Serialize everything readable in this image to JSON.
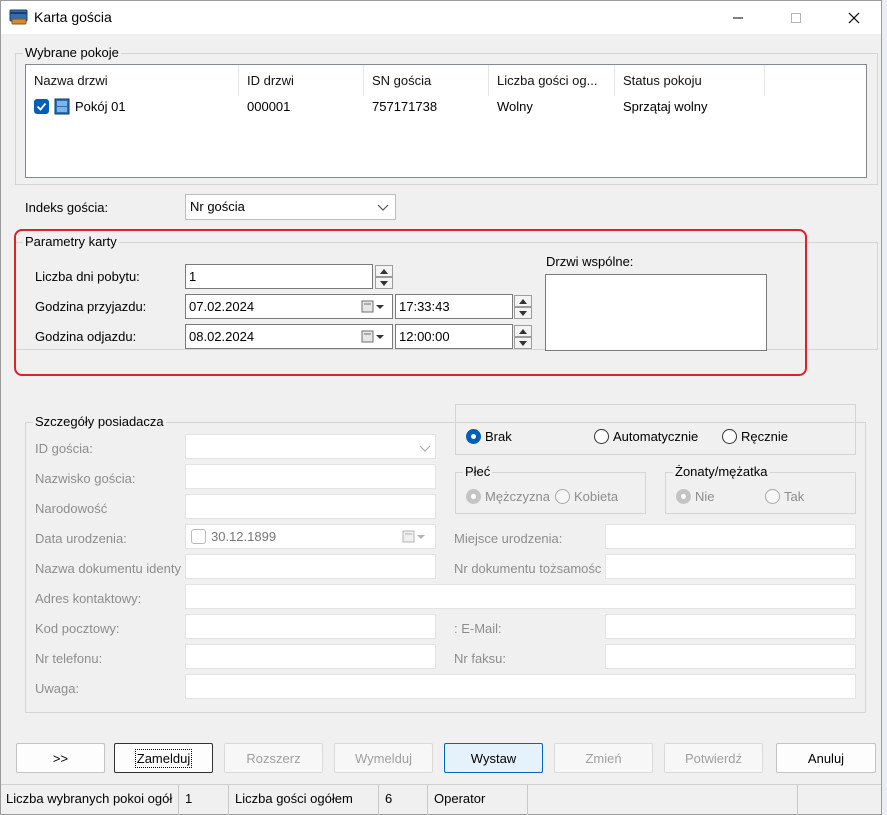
{
  "window": {
    "title": "Karta gościa"
  },
  "rooms_group": {
    "title": "Wybrane pokoje",
    "columns": [
      "Nazwa drzwi",
      "ID drzwi",
      "SN gościa",
      "Liczba gości og...",
      "Status pokoju"
    ],
    "rows": [
      {
        "name": "Pokój 01",
        "id": "000001",
        "sn": "757171738",
        "guests": "Wolny",
        "status": "Sprzątaj wolny",
        "checked": true
      }
    ]
  },
  "index": {
    "label": "Indeks gościa:",
    "value": "Nr gościa"
  },
  "card_params": {
    "title": "Parametry karty",
    "days_label": "Liczba dni pobytu:",
    "days_value": "1",
    "arrival_label": "Godzina przyjazdu:",
    "arrival_date": "07.02.2024",
    "arrival_time": "17:33:43",
    "departure_label": "Godzina odjazdu:",
    "departure_date": "08.02.2024",
    "departure_time": "12:00:00",
    "common_doors_label": "Drzwi wspólne:"
  },
  "holder": {
    "title": "Szczegóły posiadacza",
    "guest_id_label": "ID gościa:",
    "surname_label": "Nazwisko gościa:",
    "nationality_label": "Narodowość",
    "birth_date_label": "Data urodzenia:",
    "birth_date_value": "30.12.1899",
    "doc_name_label": "Nazwa dokumentu identy",
    "address_label": "Adres kontaktowy:",
    "postal_label": "Kod pocztowy:",
    "phone_label": "Nr telefonu:",
    "note_label": "Uwaga:",
    "birth_place_label": "Miejsce urodzenia:",
    "doc_number_label": "Nr dokumentu tożsamośc",
    "email_label": ": E-Mail:",
    "fax_label": "Nr faksu:",
    "mode_options": [
      "Brak",
      "Automatycznie",
      "Ręcznie"
    ],
    "mode_selected": "Brak",
    "gender_title": "Płeć",
    "gender_options": [
      "Mężczyzna",
      "Kobieta"
    ],
    "gender_selected": "Mężczyzna",
    "married_title": "Żonaty/mężatka",
    "married_options": [
      "Nie",
      "Tak"
    ],
    "married_selected": "Nie"
  },
  "buttons": {
    "more": ">>",
    "checkin": "Zamelduj",
    "extend": "Rozszerz",
    "checkout": "Wymelduj",
    "issue": "Wystaw",
    "change": "Zmień",
    "confirm": "Potwierdź",
    "cancel": "Anuluj"
  },
  "status_bar": {
    "selected_rooms_label": "Liczba wybranych pokoi ogół",
    "selected_rooms_value": "1",
    "total_guests_label": "Liczba gości ogółem",
    "total_guests_value": "6",
    "operator_label": "Operator",
    "operator_value": ""
  },
  "colors": {
    "accent": "#005fb8",
    "highlight": "#e0202a"
  }
}
